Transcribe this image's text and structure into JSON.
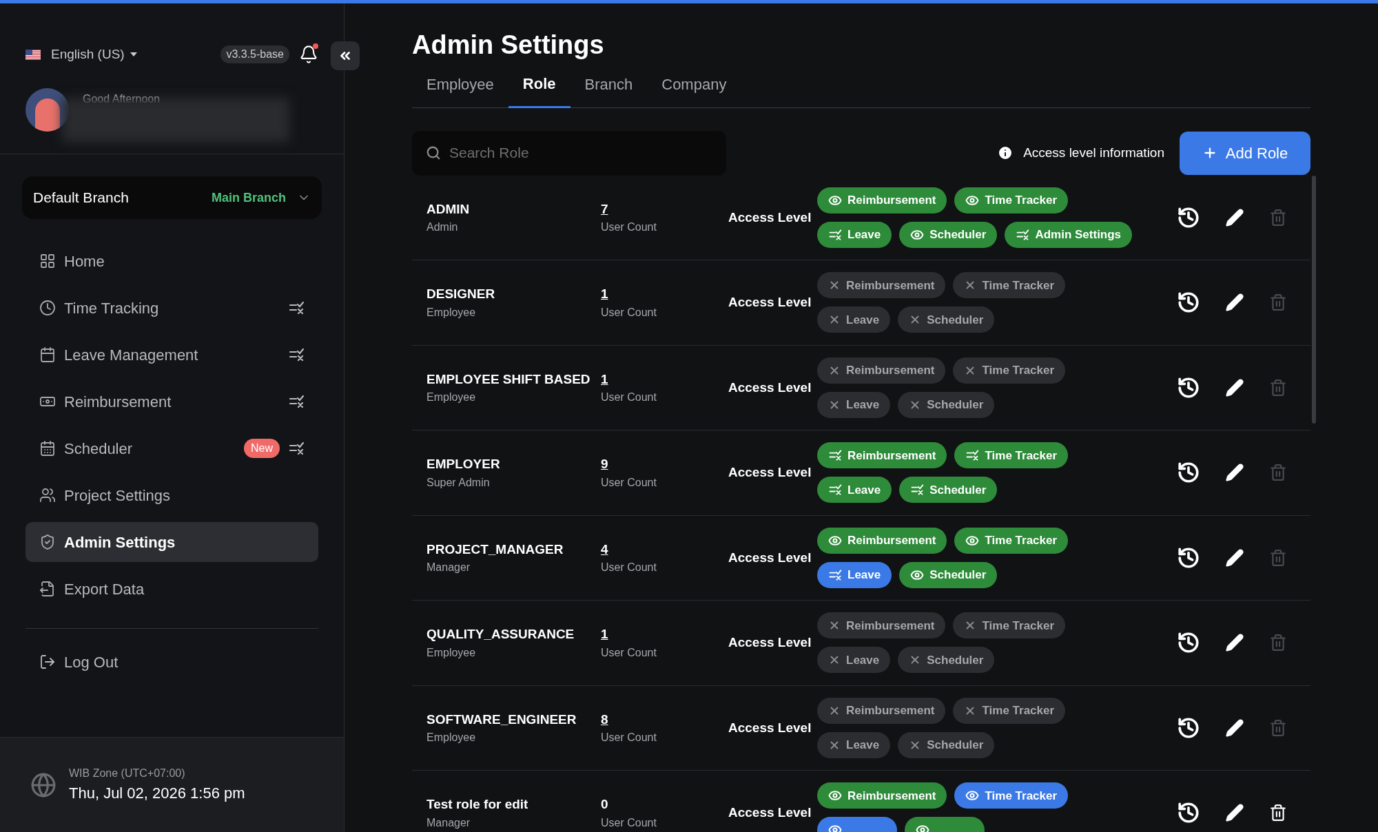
{
  "sidebar": {
    "language": "English (US)",
    "version": "v3.3.5-base",
    "notification_dot": true,
    "greeting": "Good Afternoon",
    "branch": {
      "label": "Default Branch",
      "value": "Main Branch"
    },
    "items": [
      {
        "label": "Home",
        "kind": "home",
        "selected": false,
        "access_icon": false
      },
      {
        "label": "Time Tracking",
        "kind": "clock",
        "selected": false,
        "access_icon": true
      },
      {
        "label": "Leave Management",
        "kind": "calendar",
        "selected": false,
        "access_icon": true
      },
      {
        "label": "Reimbursement",
        "kind": "money",
        "selected": false,
        "access_icon": true
      },
      {
        "label": "Scheduler",
        "kind": "schedule",
        "selected": false,
        "access_icon": true,
        "badge": "New"
      },
      {
        "label": "Project Settings",
        "kind": "users",
        "selected": false,
        "access_icon": false
      },
      {
        "label": "Admin Settings",
        "kind": "shield",
        "selected": true,
        "access_icon": false
      },
      {
        "label": "Export Data",
        "kind": "export",
        "selected": false,
        "access_icon": false
      }
    ],
    "logout": "Log Out",
    "zone": "WIB Zone (UTC+07:00)",
    "datetime": "Thu, Jul 02, 2026 1:56 pm"
  },
  "page": {
    "title": "Admin Settings",
    "tabs": [
      {
        "label": "Employee",
        "selected": false
      },
      {
        "label": "Role",
        "selected": true
      },
      {
        "label": "Branch",
        "selected": false
      },
      {
        "label": "Company",
        "selected": false
      }
    ],
    "search": {
      "placeholder": "Search Role"
    },
    "info_link": "Access level information",
    "add_button": "Add Role",
    "roles": [
      {
        "name": "ADMIN",
        "type": "Admin",
        "count": "7",
        "count_link": true,
        "count_label": "User Count",
        "access_label": "Access Level",
        "delete_disabled": true,
        "access_lines": [
          [
            {
              "label": "Reimbursement",
              "kind": "view",
              "color": "#2e8b3a"
            },
            {
              "label": "Time Tracker",
              "kind": "view",
              "color": "#2e8b3a"
            }
          ],
          [
            {
              "label": "Leave",
              "kind": "manage",
              "color": "#2e8b3a"
            },
            {
              "label": "Scheduler",
              "kind": "view",
              "color": "#2e8b3a"
            },
            {
              "label": "Admin Settings",
              "kind": "manage",
              "color": "#2e8b3a"
            }
          ]
        ]
      },
      {
        "name": "DESIGNER",
        "type": "Employee",
        "count": "1",
        "count_link": true,
        "count_label": "User Count",
        "access_label": "Access Level",
        "delete_disabled": true,
        "access_lines": [
          [
            {
              "label": "Reimbursement",
              "kind": "none",
              "color": "#2c2d31"
            },
            {
              "label": "Time Tracker",
              "kind": "none",
              "color": "#2c2d31"
            }
          ],
          [
            {
              "label": "Leave",
              "kind": "none",
              "color": "#2c2d31"
            },
            {
              "label": "Scheduler",
              "kind": "none",
              "color": "#2c2d31"
            }
          ]
        ]
      },
      {
        "name": "EMPLOYEE SHIFT BASED",
        "type": "Employee",
        "count": "1",
        "count_link": true,
        "count_label": "User Count",
        "access_label": "Access Level",
        "delete_disabled": true,
        "access_lines": [
          [
            {
              "label": "Reimbursement",
              "kind": "none",
              "color": "#2c2d31"
            },
            {
              "label": "Time Tracker",
              "kind": "none",
              "color": "#2c2d31"
            }
          ],
          [
            {
              "label": "Leave",
              "kind": "none",
              "color": "#2c2d31"
            },
            {
              "label": "Scheduler",
              "kind": "none",
              "color": "#2c2d31"
            }
          ]
        ]
      },
      {
        "name": "EMPLOYER",
        "type": "Super Admin",
        "count": "9",
        "count_link": true,
        "count_label": "User Count",
        "access_label": "Access Level",
        "delete_disabled": true,
        "access_lines": [
          [
            {
              "label": "Reimbursement",
              "kind": "manage",
              "color": "#2e8b3a"
            },
            {
              "label": "Time Tracker",
              "kind": "manage",
              "color": "#2e8b3a"
            }
          ],
          [
            {
              "label": "Leave",
              "kind": "manage",
              "color": "#2e8b3a"
            },
            {
              "label": "Scheduler",
              "kind": "manage",
              "color": "#2e8b3a"
            }
          ]
        ]
      },
      {
        "name": "PROJECT_MANAGER",
        "type": "Manager",
        "count": "4",
        "count_link": true,
        "count_label": "User Count",
        "access_label": "Access Level",
        "delete_disabled": true,
        "access_lines": [
          [
            {
              "label": "Reimbursement",
              "kind": "view",
              "color": "#2e8b3a"
            },
            {
              "label": "Time Tracker",
              "kind": "view",
              "color": "#2e8b3a"
            }
          ],
          [
            {
              "label": "Leave",
              "kind": "manage",
              "color": "#3b7ae6"
            },
            {
              "label": "Scheduler",
              "kind": "view",
              "color": "#2e8b3a"
            }
          ]
        ]
      },
      {
        "name": "QUALITY_ASSURANCE",
        "type": "Employee",
        "count": "1",
        "count_link": true,
        "count_label": "User Count",
        "access_label": "Access Level",
        "delete_disabled": true,
        "access_lines": [
          [
            {
              "label": "Reimbursement",
              "kind": "none",
              "color": "#2c2d31"
            },
            {
              "label": "Time Tracker",
              "kind": "none",
              "color": "#2c2d31"
            }
          ],
          [
            {
              "label": "Leave",
              "kind": "none",
              "color": "#2c2d31"
            },
            {
              "label": "Scheduler",
              "kind": "none",
              "color": "#2c2d31"
            }
          ]
        ]
      },
      {
        "name": "SOFTWARE_ENGINEER",
        "type": "Employee",
        "count": "8",
        "count_link": true,
        "count_label": "User Count",
        "access_label": "Access Level",
        "delete_disabled": true,
        "access_lines": [
          [
            {
              "label": "Reimbursement",
              "kind": "none",
              "color": "#2c2d31"
            },
            {
              "label": "Time Tracker",
              "kind": "none",
              "color": "#2c2d31"
            }
          ],
          [
            {
              "label": "Leave",
              "kind": "none",
              "color": "#2c2d31"
            },
            {
              "label": "Scheduler",
              "kind": "none",
              "color": "#2c2d31"
            }
          ]
        ]
      },
      {
        "name": "Test role for edit",
        "type": "Manager",
        "count": "0",
        "count_link": false,
        "count_label": "User Count",
        "access_label": "Access Level",
        "delete_disabled": false,
        "access_lines": [
          [
            {
              "label": "Reimbursement",
              "kind": "view",
              "color": "#2e8b3a"
            },
            {
              "label": "Time Tracker",
              "kind": "view",
              "color": "#3b7ae6"
            }
          ],
          [
            {
              "kind": "view",
              "color": "#3b7ae6"
            },
            {
              "kind": "view",
              "color": "#2e8b3a"
            }
          ]
        ]
      }
    ]
  }
}
